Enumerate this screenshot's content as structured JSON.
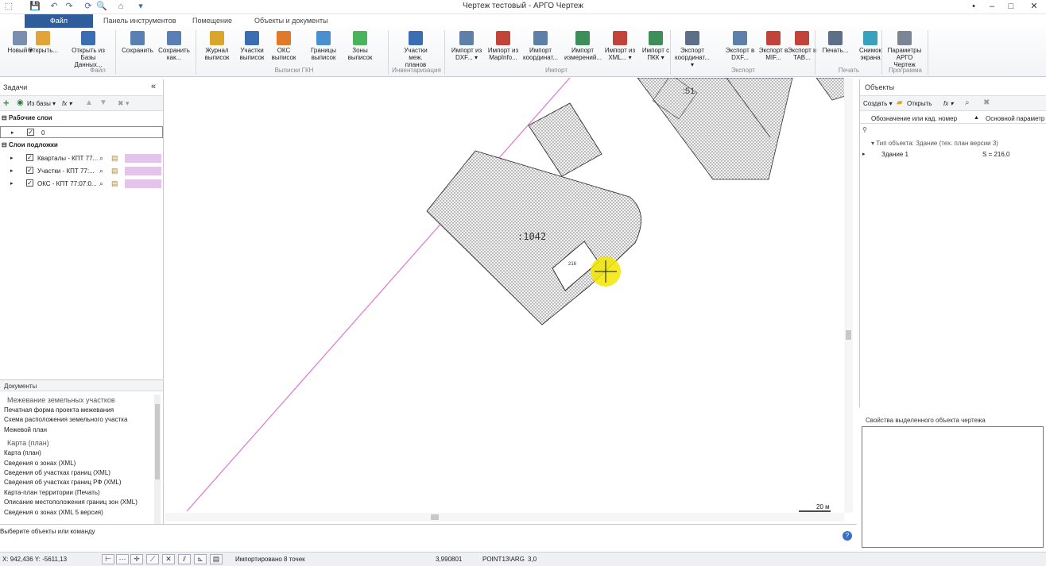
{
  "window": {
    "title": "Чертеж тестовый - АРГО Чертеж",
    "quick_access": [
      "💾",
      "↶",
      "↷",
      "⟳",
      "🔍",
      "⌂",
      "▾"
    ],
    "controls": [
      "•",
      "–",
      "□",
      "✕"
    ]
  },
  "tabs": [
    "Файл",
    "Панель инструментов",
    "Помещение",
    "Объекты и документы"
  ],
  "ribbon": {
    "buttons": [
      {
        "label": "Новый ▾",
        "color": "#7a8fb0"
      },
      {
        "label": "Открыть...",
        "color": "#e0a43a"
      },
      {
        "label": "Открыть из Базы Данных...",
        "color": "#3b6db3"
      },
      {
        "label": "Сохранить",
        "color": "#5a7fb5"
      },
      {
        "label": "Сохранить как...",
        "color": "#5a7fb5"
      },
      {
        "label": "Журнал выписок",
        "color": "#d9a52a"
      },
      {
        "label": "Участки выписок",
        "color": "#3b6db3"
      },
      {
        "label": "ОКС выписок",
        "color": "#e07a2a"
      },
      {
        "label": "Границы выписок",
        "color": "#4a8fd0"
      },
      {
        "label": "Зоны выписок",
        "color": "#4bb35c"
      },
      {
        "label": "Участки меж. планов",
        "color": "#3b6db3"
      },
      {
        "label": "Импорт из DXF... ▾",
        "color": "#5d7fa8"
      },
      {
        "label": "Импорт из MapInfo...",
        "color": "#c0443a"
      },
      {
        "label": "Импорт координат...",
        "color": "#5d7fa8"
      },
      {
        "label": "Импорт измерений...",
        "color": "#3e8e5a"
      },
      {
        "label": "Импорт из XML... ▾",
        "color": "#c0443a"
      },
      {
        "label": "Импорт с ПКК ▾",
        "color": "#3e8e5a"
      },
      {
        "label": "Экспорт координат... ▾",
        "color": "#5d6f88"
      },
      {
        "label": "Экспорт в DXF...",
        "color": "#5d7fa8"
      },
      {
        "label": "Экспорт в MIF...",
        "color": "#c0443a"
      },
      {
        "label": "Экспорт в TAB...",
        "color": "#c0443a"
      },
      {
        "label": "Печать...",
        "color": "#5d6f88"
      },
      {
        "label": "Снимок экрана",
        "color": "#3aa0c0"
      },
      {
        "label": "Параметры АРГО Чертеж",
        "color": "#7a8696"
      }
    ],
    "groups": [
      "Файл",
      "Выписки ГКН",
      "Инвентаризация",
      "Импорт",
      "Экспорт",
      "Печать",
      "Программа"
    ]
  },
  "tasks": {
    "title": "Задачи",
    "collapse": "«",
    "toolbar": {
      "add": "+",
      "from_db": "Из базы ▾",
      "fx": "fx ▾",
      "remove": "✖ ▾"
    },
    "working_layers_title": "Рабочие слои",
    "working_layers": [
      {
        "name": "0"
      }
    ],
    "background_layers_title": "Слои подложки",
    "background_layers": [
      {
        "name": "Кварталы - КПТ 77..."
      },
      {
        "name": "Участки - КПТ 77:..."
      },
      {
        "name": "ОКС - КПТ 77:07:0..."
      }
    ]
  },
  "documents": {
    "title": "Документы",
    "sections": [
      {
        "title": "Межевание земельных участков",
        "items": [
          "Печатная форма проекта межевания",
          "Схема расположения земельного участка",
          "Межевой план"
        ]
      },
      {
        "title": "Карта (план)",
        "items": [
          "Карта (план)",
          "Сведения о зонах (XML)",
          "Сведения об участках границ (XML)",
          "Сведения об участках границ РФ (XML)",
          "Карта-план территории (Печать)",
          "Описание местоположения границ зон (XML)",
          "Сведения о зонах (XML 5 версия)"
        ]
      }
    ]
  },
  "canvas": {
    "parcel_label": ":1042",
    "building_area_label": "216",
    "neighbor_label": ":51",
    "scale_label": "20 м"
  },
  "objects": {
    "title": "Объекты",
    "create": "Создать ▾",
    "open": "Открыть",
    "fx": "fx ▾",
    "col_name": "Обозначение или кад. номер",
    "col_param": "Основной параметр",
    "group_row": "Тип объекта: Здание (тех. план версии 3)",
    "rows": [
      {
        "name": "Здание 1",
        "param": "S = 216,0"
      }
    ]
  },
  "properties": {
    "title": "Свойства выделенного объекта чертежа"
  },
  "command": {
    "prompt": "Выберите объекты или команду"
  },
  "status": {
    "coords": "X: 942,436 Y: -5611,13",
    "message": "Импортировано 8 точек",
    "value1": "3,990801",
    "snap": "POINT13\\ARG",
    "value2": "3,0"
  },
  "colors": {
    "accent": "#2f5d9b",
    "layer_swatch": "#e5c4ec",
    "road_line": "#e080d0",
    "highlight": "#f2e600"
  }
}
